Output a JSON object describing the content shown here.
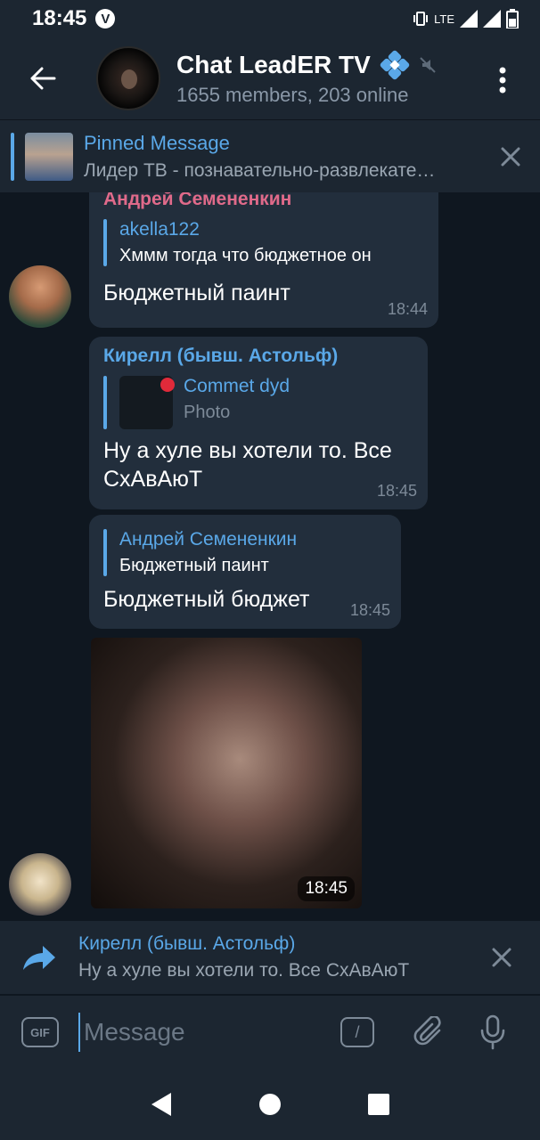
{
  "status_bar": {
    "time": "18:45",
    "carrier_badge": "V",
    "network": "LTE"
  },
  "header": {
    "title": "Chat LeadER TV",
    "subtitle": "1655 members, 203 online",
    "icons": [
      "back-arrow-icon",
      "verified-badge-icon",
      "muted-icon",
      "more-vert-icon"
    ]
  },
  "pinned": {
    "title": "Pinned Message",
    "text": "Лидер ТВ - познавательно-развлекате…"
  },
  "messages": [
    {
      "sender": "Андрей Семененкин",
      "sender_color": "#e06a8a",
      "reply_name": "akella122",
      "reply_text": "Хммм тогда что бюджетное он",
      "text": "Бюджетный паинт",
      "time": "18:44"
    },
    {
      "sender": "Кирелл (бывш. Астольф)",
      "sender_color": "#5aa8e8",
      "reply_name": "Commet dyd",
      "reply_text": "Photo",
      "text_line1": "Ну а хуле вы хотели то. Все",
      "text_line2": "СхАвАюТ",
      "time": "18:45"
    },
    {
      "reply_name": "Андрей Семененкин",
      "reply_text": "Бюджетный паинт",
      "text": "Бюджетный бюджет",
      "time": "18:45"
    },
    {
      "type": "photo",
      "time": "18:45"
    }
  ],
  "reply_panel": {
    "name": "Кирелл (бывш. Астольф)",
    "text": "Ну а хуле вы хотели то. Все СхАвАюТ"
  },
  "input": {
    "placeholder": "Message",
    "gif_label": "GIF",
    "command_label": "/"
  },
  "colors": {
    "accent": "#5aa8e8",
    "header_bg": "#1c2631",
    "bubble_bg": "#222e3c",
    "chat_bg": "#0f1720"
  }
}
